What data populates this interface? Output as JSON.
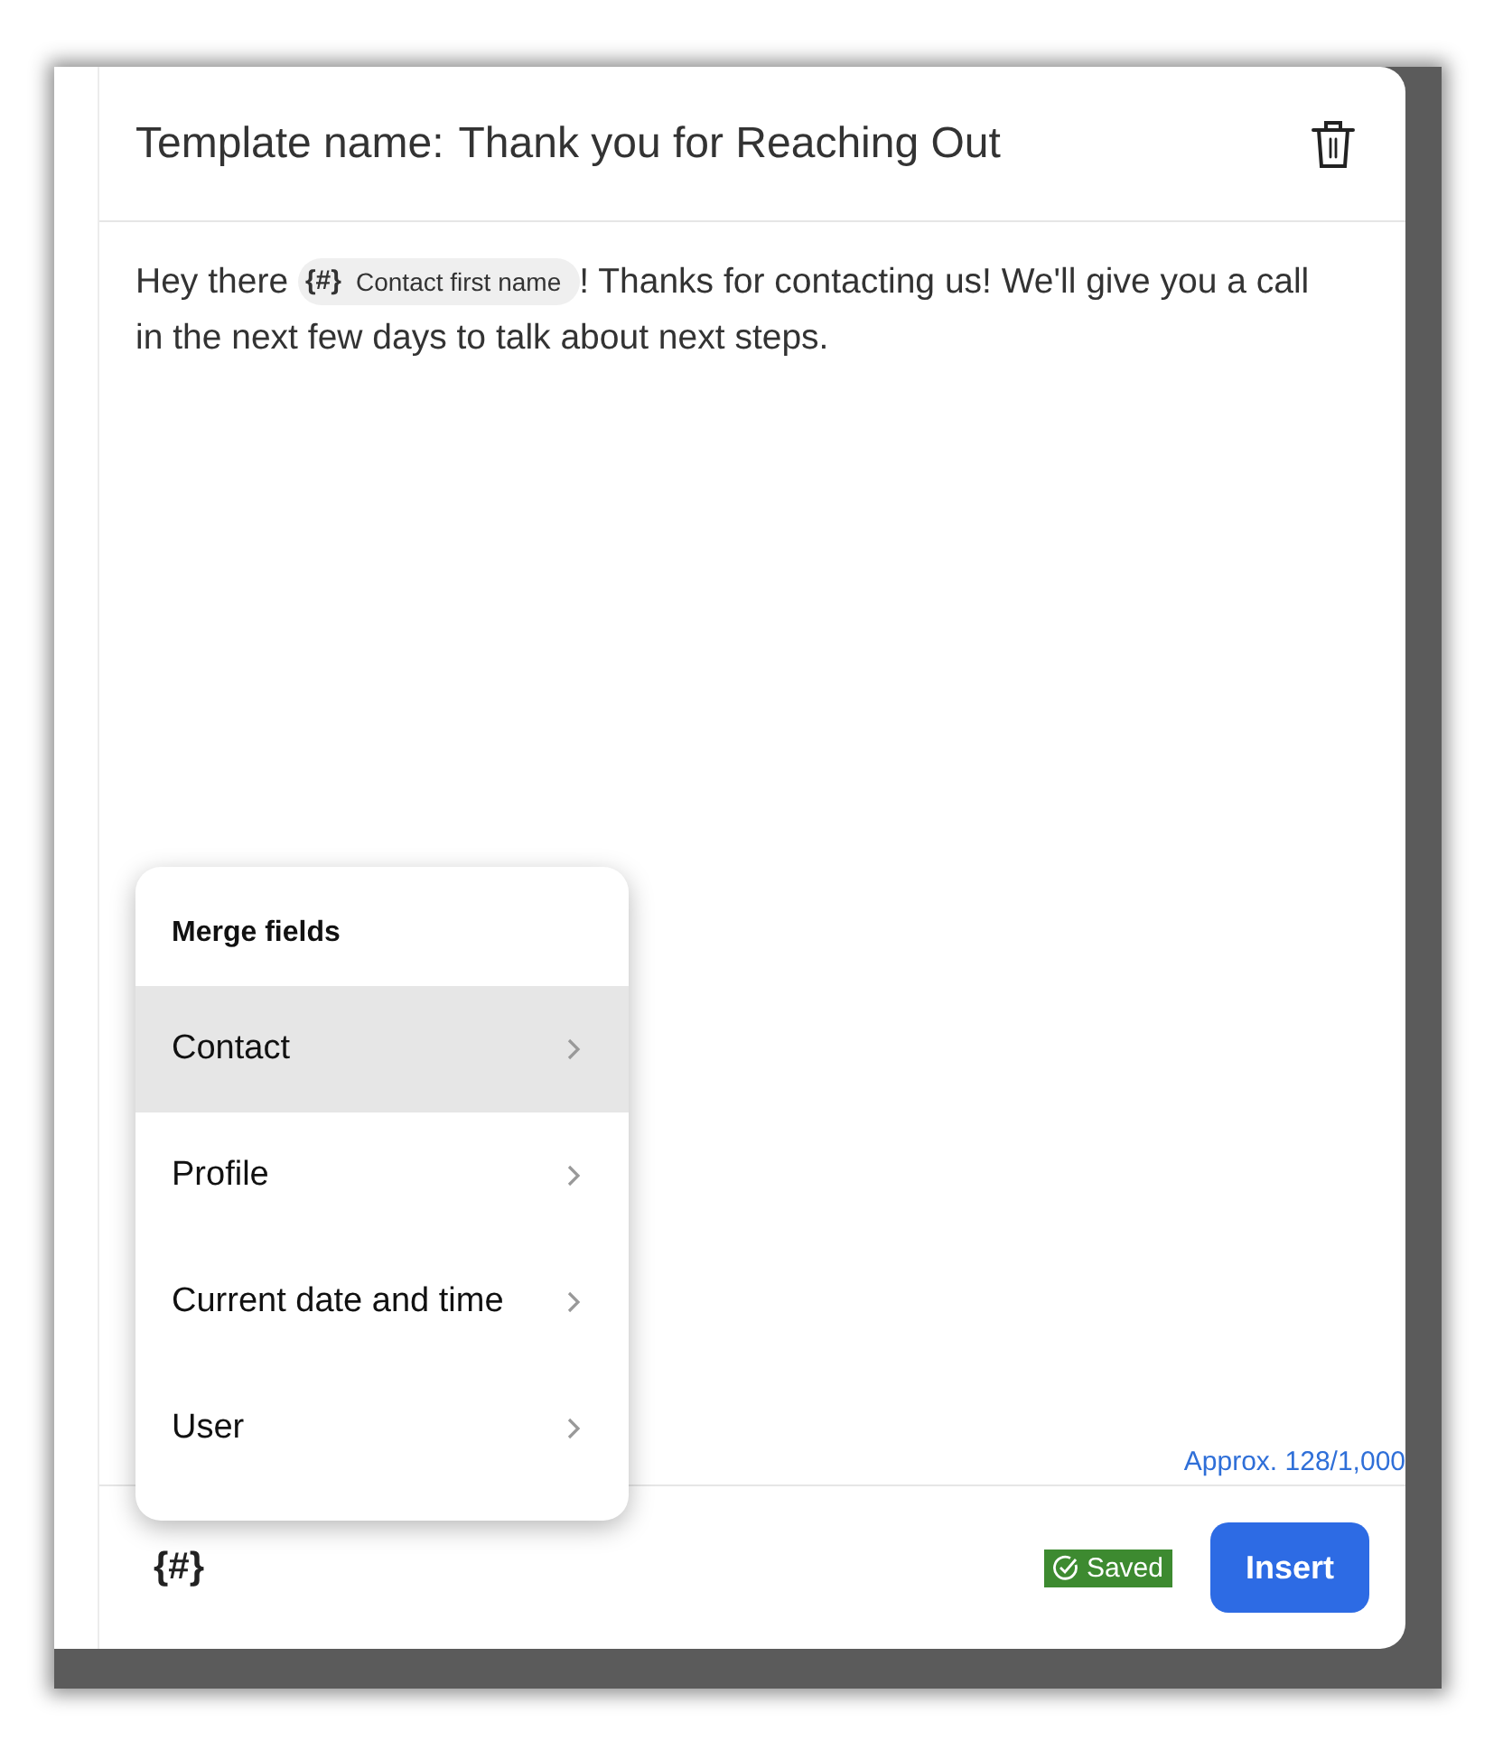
{
  "dialog": {
    "title_label": "Template name:",
    "title_value": "Thank you for Reaching Out",
    "message": {
      "before": "Hey there ",
      "chip": {
        "icon": "{#}",
        "label": "Contact first name"
      },
      "after": "! Thanks for contacting us! We'll give you a call in the next few days to talk about next steps."
    },
    "counter": "Approx. 128/1,000",
    "merge_menu": {
      "title": "Merge fields",
      "items": [
        {
          "label": "Contact",
          "selected": true
        },
        {
          "label": "Profile",
          "selected": false
        },
        {
          "label": "Current date and time",
          "selected": false
        },
        {
          "label": "User",
          "selected": false
        }
      ]
    },
    "footer": {
      "merge_button": "{#}",
      "status": "Saved",
      "insert_button": "Insert"
    }
  }
}
